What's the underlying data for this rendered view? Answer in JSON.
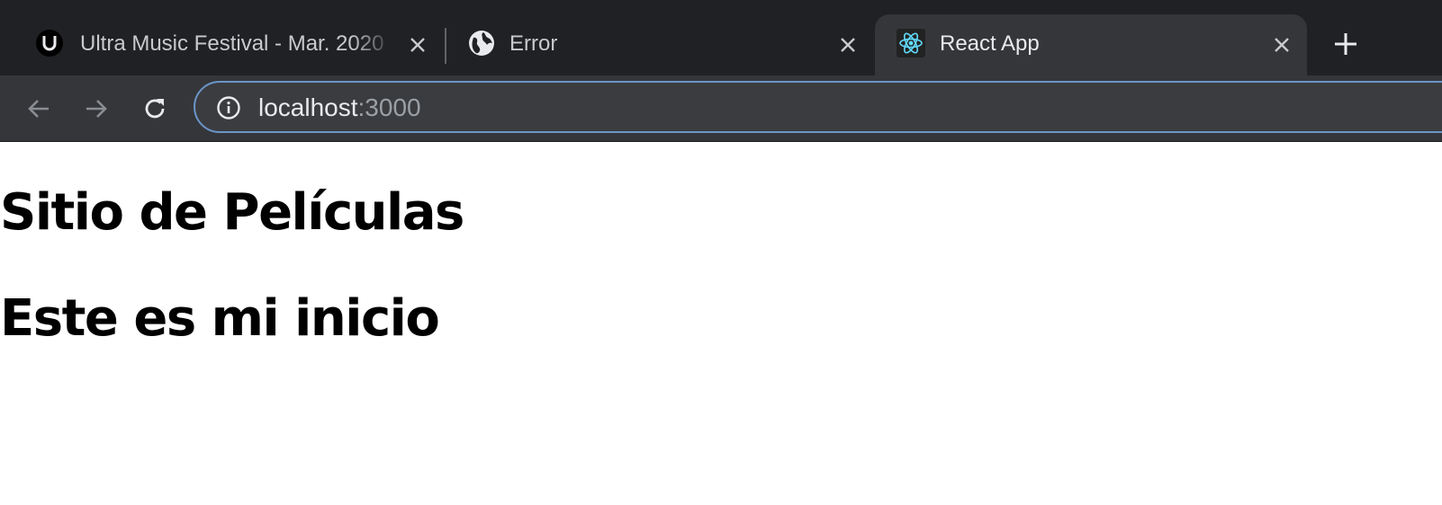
{
  "browser": {
    "tabs": [
      {
        "title": "Ultra Music Festival - Mar. 2020",
        "favicon": "ultra-logo-icon",
        "active": false
      },
      {
        "title": "Error",
        "favicon": "globe-icon",
        "active": false
      },
      {
        "title": "React App",
        "favicon": "react-logo-icon",
        "active": true
      }
    ],
    "address": {
      "host": "localhost",
      "port": ":3000"
    }
  },
  "page": {
    "heading_1": "Sitio de Películas",
    "heading_2": "Este es mi inicio"
  },
  "colors": {
    "tabstrip": "#202124",
    "toolbar": "#35363a",
    "omnibox": "#3b3c3f",
    "focus_ring": "#6b95c9",
    "react": "#61dafb"
  }
}
